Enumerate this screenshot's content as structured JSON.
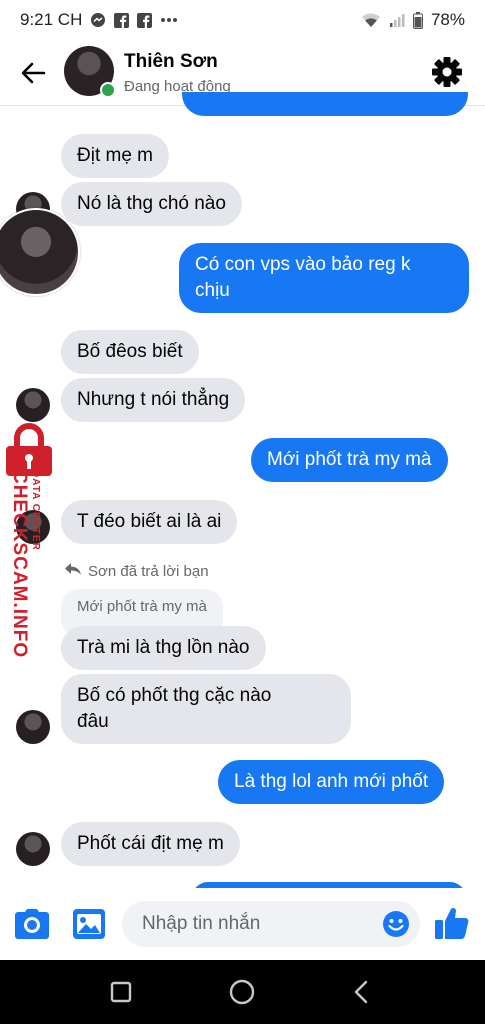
{
  "status_bar": {
    "time": "9:21 CH",
    "battery": "78%"
  },
  "header": {
    "name": "Thiên Sơn",
    "status": "Đang hoạt động"
  },
  "messages": [
    {
      "text": "Địt mẹ m"
    },
    {
      "text": "Nó là thg chó nào"
    },
    {
      "text": "Có con vps vào bảo reg k chịu",
      "line1": "Có con vps vào bảo reg k",
      "line2": "chịu"
    },
    {
      "text": "Bố đêos biết"
    },
    {
      "text": "Nhưng t nói thẳng"
    },
    {
      "text": "Mới phốt trà my mà"
    },
    {
      "text": "T đéo biết ai là ai"
    },
    {
      "text": "Trà mi là thg lồn nào"
    },
    {
      "text": "Bố có phốt thg cặc nào đâu",
      "line1": "Bố có phốt thg cặc nào",
      "line2": "đâu"
    },
    {
      "text": "Là thg lol anh mới phốt"
    },
    {
      "text": "Phốt cái địt mẹ m"
    }
  ],
  "reply_context": {
    "note": "Sơn đã trả lời bạn",
    "quoted": "Mới phốt trà my mà"
  },
  "composer": {
    "placeholder": "Nhập tin nhắn"
  },
  "watermark": {
    "brand": "CHECKSCAM.INFO",
    "tag": "DATA CENTER"
  },
  "colors": {
    "outgoing": "#1877f2",
    "incoming": "#e4e6eb",
    "accent": "#1877f2",
    "watermark": "#d0202c"
  },
  "icons": [
    "back-arrow-icon",
    "gear-icon",
    "camera-icon",
    "gallery-icon",
    "emoji-icon",
    "like-icon",
    "square-nav-icon",
    "circle-nav-icon",
    "back-nav-icon"
  ]
}
